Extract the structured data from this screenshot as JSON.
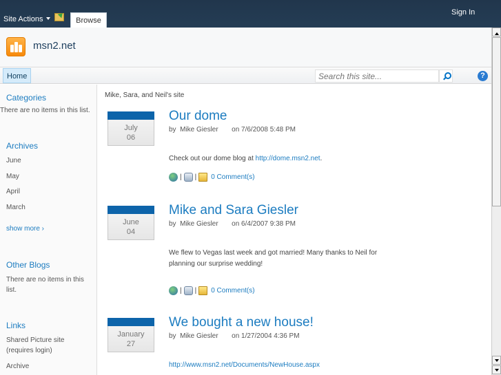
{
  "topbar": {
    "site_actions": "Site Actions",
    "browse_tab": "Browse",
    "sign_in": "Sign In"
  },
  "header": {
    "site_title": "msn2.net"
  },
  "nav": {
    "home": "Home",
    "search_placeholder": "Search this site...",
    "help": "?"
  },
  "sidebar": {
    "categories": {
      "title": "Categories",
      "empty": "There are no items in this list."
    },
    "archives": {
      "title": "Archives",
      "items": [
        "June",
        "May",
        "April",
        "March"
      ],
      "show_more": "show more ›"
    },
    "other_blogs": {
      "title": "Other Blogs",
      "empty": "There are no items in this list."
    },
    "links": {
      "title": "Links",
      "items": [
        "Shared Picture site (requires login)",
        "Archive"
      ]
    }
  },
  "main": {
    "breadcrumb": "Mike, Sara, and Neil's site",
    "posts": [
      {
        "month": "July",
        "day": "06",
        "title": "Our dome",
        "meta": "by  Mike Giesler       on 7/6/2008 5:48 PM",
        "body": "Check out our dome blog at ",
        "link": "http://dome.msn2.net",
        "body_end": ".",
        "comments": "0 Comment(s)"
      },
      {
        "month": "June",
        "day": "04",
        "title": "Mike and Sara Giesler",
        "meta": "by  Mike Giesler       on 6/4/2007 9:38 PM",
        "body": "We flew to Vegas last week and got married!  Many thanks to Neil for planning our surprise wedding!",
        "comments": "0 Comment(s)"
      },
      {
        "month": "January",
        "day": "27",
        "title": "We bought a new house!",
        "meta": "by  Mike Giesler       on 1/27/2004 4:36 PM",
        "link": "http://www.msn2.net/Documents/NewHouse.aspx"
      }
    ]
  },
  "colors": {
    "topbar": "#21364c",
    "accent": "#1c7cc0",
    "date_bar": "#0d64aa",
    "logo": "#f78a0b"
  }
}
